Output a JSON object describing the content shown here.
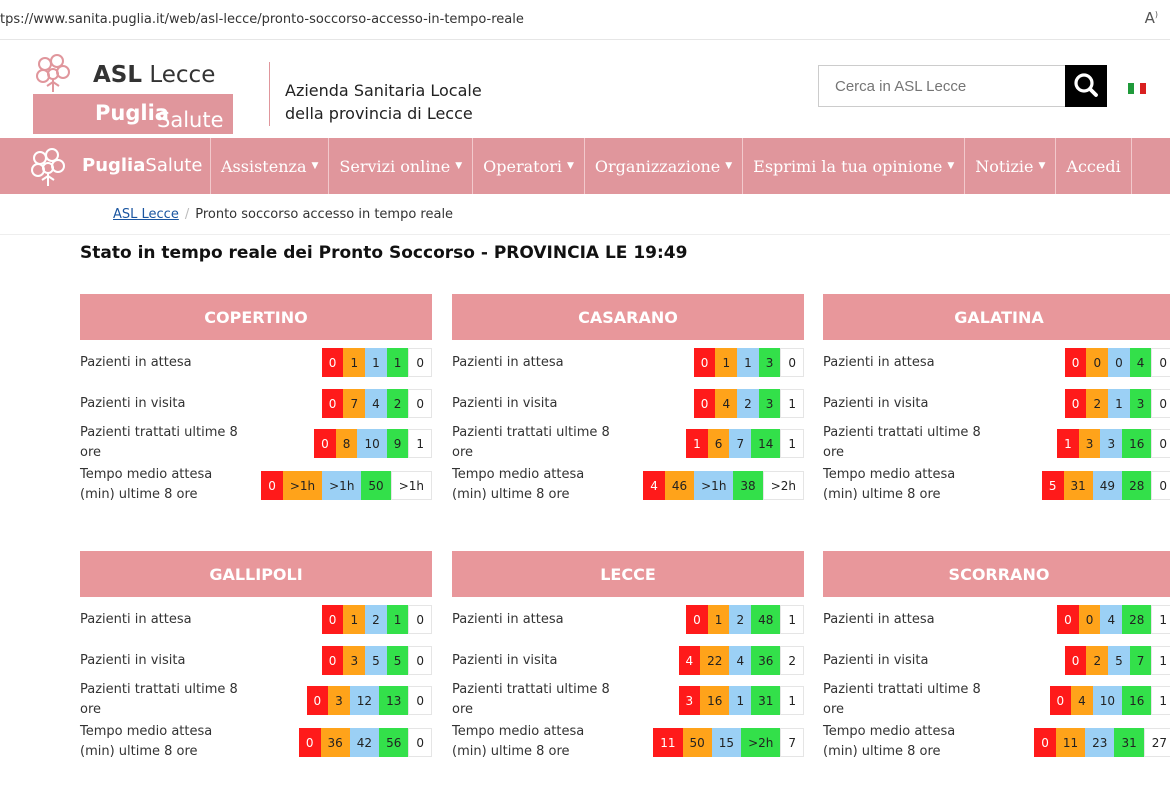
{
  "browser": {
    "url": "tps://www.sanita.puglia.it/web/asl-lecce/pronto-soccorso-accesso-in-tempo-reale",
    "reader_icon": "read-aloud-icon"
  },
  "header": {
    "logo_asl_bold": "ASL",
    "logo_asl_rest": " Lecce",
    "logo_brand_bold": "Puglia",
    "logo_brand_rest": "Salute",
    "azienda_line1": "Azienda Sanitaria Locale",
    "azienda_line2": "della provincia di Lecce",
    "search_placeholder": "Cerca in ASL Lecce",
    "search_icon": "search-icon",
    "flag_icon": "italian-flag-icon"
  },
  "nav": {
    "brand_bold": "Puglia",
    "brand_rest": "Salute",
    "items": [
      {
        "label": "Assistenza",
        "caret": "▼"
      },
      {
        "label": "Servizi online",
        "caret": "▼"
      },
      {
        "label": "Operatori",
        "caret": "▼"
      },
      {
        "label": "Organizzazione",
        "caret": "▼"
      },
      {
        "label": "Esprimi la tua opinione",
        "caret": "▼"
      },
      {
        "label": "Notizie",
        "caret": "▼"
      },
      {
        "label": "Accedi",
        "caret": ""
      }
    ]
  },
  "breadcrumb": {
    "home": "ASL Lecce",
    "separator": "/",
    "current": "Pronto soccorso accesso in tempo reale"
  },
  "page_title": "Stato in tempo reale dei Pronto Soccorso - PROVINCIA LE 19:49",
  "colors": {
    "brand_pink": "#e0969c",
    "red": "#ff1a1a",
    "orange": "#ffa31a",
    "blue": "#9bd0f5",
    "green": "#33e04a"
  },
  "cards": [
    {
      "name": "COPERTINO",
      "rows": [
        {
          "label": "Pazienti in attesa",
          "values": [
            "0",
            "1",
            "1",
            "1",
            "0"
          ]
        },
        {
          "label": "Pazienti in visita",
          "values": [
            "0",
            "7",
            "4",
            "2",
            "0"
          ]
        },
        {
          "label": "Pazienti trattati ultime 8 ore",
          "values": [
            "0",
            "8",
            "10",
            "9",
            "1"
          ]
        },
        {
          "label": "Tempo medio attesa (min) ultime 8 ore",
          "values": [
            "0",
            ">1h",
            ">1h",
            "50",
            ">1h"
          ]
        }
      ]
    },
    {
      "name": "CASARANO",
      "rows": [
        {
          "label": "Pazienti in attesa",
          "values": [
            "0",
            "1",
            "1",
            "3",
            "0"
          ]
        },
        {
          "label": "Pazienti in visita",
          "values": [
            "0",
            "4",
            "2",
            "3",
            "1"
          ]
        },
        {
          "label": "Pazienti trattati ultime 8 ore",
          "values": [
            "1",
            "6",
            "7",
            "14",
            "1"
          ]
        },
        {
          "label": "Tempo medio attesa (min) ultime 8 ore",
          "values": [
            "4",
            "46",
            ">1h",
            "38",
            ">2h"
          ]
        }
      ]
    },
    {
      "name": "GALATINA",
      "rows": [
        {
          "label": "Pazienti in attesa",
          "values": [
            "0",
            "0",
            "0",
            "4",
            "0"
          ]
        },
        {
          "label": "Pazienti in visita",
          "values": [
            "0",
            "2",
            "1",
            "3",
            "0"
          ]
        },
        {
          "label": "Pazienti trattati ultime 8 ore",
          "values": [
            "1",
            "3",
            "3",
            "16",
            "0"
          ]
        },
        {
          "label": "Tempo medio attesa (min) ultime 8 ore",
          "values": [
            "5",
            "31",
            "49",
            "28",
            "0"
          ]
        }
      ]
    },
    {
      "name": "GALLIPOLI",
      "rows": [
        {
          "label": "Pazienti in attesa",
          "values": [
            "0",
            "1",
            "2",
            "1",
            "0"
          ]
        },
        {
          "label": "Pazienti in visita",
          "values": [
            "0",
            "3",
            "5",
            "5",
            "0"
          ]
        },
        {
          "label": "Pazienti trattati ultime 8 ore",
          "values": [
            "0",
            "3",
            "12",
            "13",
            "0"
          ]
        },
        {
          "label": "Tempo medio attesa (min) ultime 8 ore",
          "values": [
            "0",
            "36",
            "42",
            "56",
            "0"
          ]
        }
      ]
    },
    {
      "name": "LECCE",
      "rows": [
        {
          "label": "Pazienti in attesa",
          "values": [
            "0",
            "1",
            "2",
            "48",
            "1"
          ]
        },
        {
          "label": "Pazienti in visita",
          "values": [
            "4",
            "22",
            "4",
            "36",
            "2"
          ]
        },
        {
          "label": "Pazienti trattati ultime 8 ore",
          "values": [
            "3",
            "16",
            "1",
            "31",
            "1"
          ]
        },
        {
          "label": "Tempo medio attesa (min) ultime 8 ore",
          "values": [
            "11",
            "50",
            "15",
            ">2h",
            "7"
          ]
        }
      ]
    },
    {
      "name": "SCORRANO",
      "rows": [
        {
          "label": "Pazienti in attesa",
          "values": [
            "0",
            "0",
            "4",
            "28",
            "1"
          ]
        },
        {
          "label": "Pazienti in visita",
          "values": [
            "0",
            "2",
            "5",
            "7",
            "1"
          ]
        },
        {
          "label": "Pazienti trattati ultime 8 ore",
          "values": [
            "0",
            "4",
            "10",
            "16",
            "1"
          ]
        },
        {
          "label": "Tempo medio attesa (min) ultime 8 ore",
          "values": [
            "0",
            "11",
            "23",
            "31",
            "27"
          ]
        }
      ]
    }
  ]
}
